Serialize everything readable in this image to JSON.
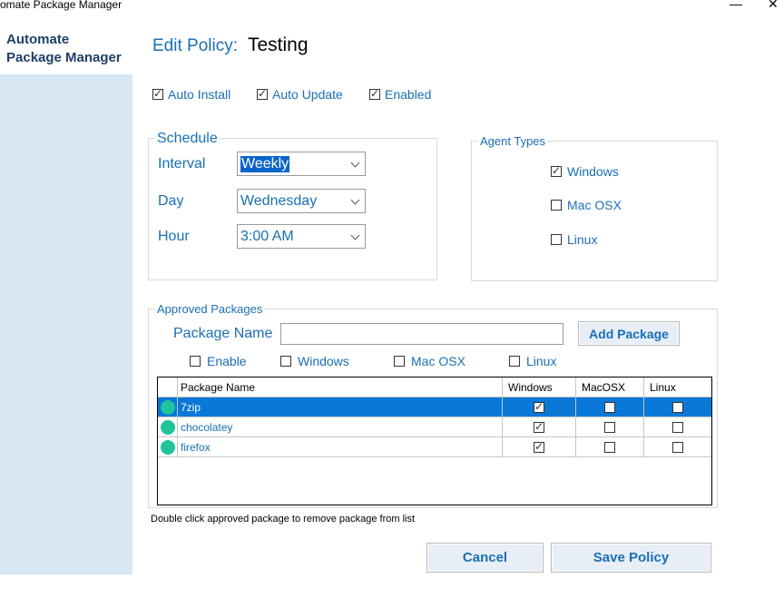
{
  "window": {
    "title": "omate Package Manager",
    "min_glyph": "—",
    "close_glyph": "✕"
  },
  "sidebar": {
    "title_line1": "Automate",
    "title_line2": "Package Manager"
  },
  "header": {
    "edit_label": "Edit Policy:",
    "policy_name": "Testing"
  },
  "options": [
    {
      "label": "Auto Install",
      "checked": true
    },
    {
      "label": "Auto Update",
      "checked": true
    },
    {
      "label": "Enabled",
      "checked": true
    }
  ],
  "schedule": {
    "legend": "Schedule",
    "interval_label": "Interval",
    "interval_value": "Weekly",
    "day_label": "Day",
    "day_value": "Wednesday",
    "hour_label": "Hour",
    "hour_value": "3:00 AM"
  },
  "agent_types": {
    "legend": "Agent Types",
    "items": [
      {
        "label": "Windows",
        "checked": true
      },
      {
        "label": "Mac OSX",
        "checked": false
      },
      {
        "label": "Linux",
        "checked": false
      }
    ]
  },
  "approved": {
    "legend": "Approved Packages",
    "package_name_label": "Package Name",
    "package_name_value": "",
    "add_button": "Add Package",
    "filters": [
      {
        "label": "Enable",
        "checked": false
      },
      {
        "label": "Windows",
        "checked": false
      },
      {
        "label": "Mac OSX",
        "checked": false
      },
      {
        "label": "Linux",
        "checked": false
      }
    ],
    "columns": [
      "Package Name",
      "Windows",
      "MacOSX",
      "Linux"
    ],
    "rows": [
      {
        "name": "7zip",
        "windows": true,
        "macosx": false,
        "linux": false,
        "selected": true
      },
      {
        "name": "chocolatey",
        "windows": true,
        "macosx": false,
        "linux": false,
        "selected": false
      },
      {
        "name": "firefox",
        "windows": true,
        "macosx": false,
        "linux": false,
        "selected": false
      }
    ],
    "hint": "Double click approved package to remove package from list"
  },
  "footer": {
    "cancel": "Cancel",
    "save": "Save Policy"
  },
  "colors": {
    "accent": "#1a6fb5",
    "sidebar": "#d6e6f2",
    "selection": "#0a78d7",
    "status_dot": "#1fc49b"
  }
}
